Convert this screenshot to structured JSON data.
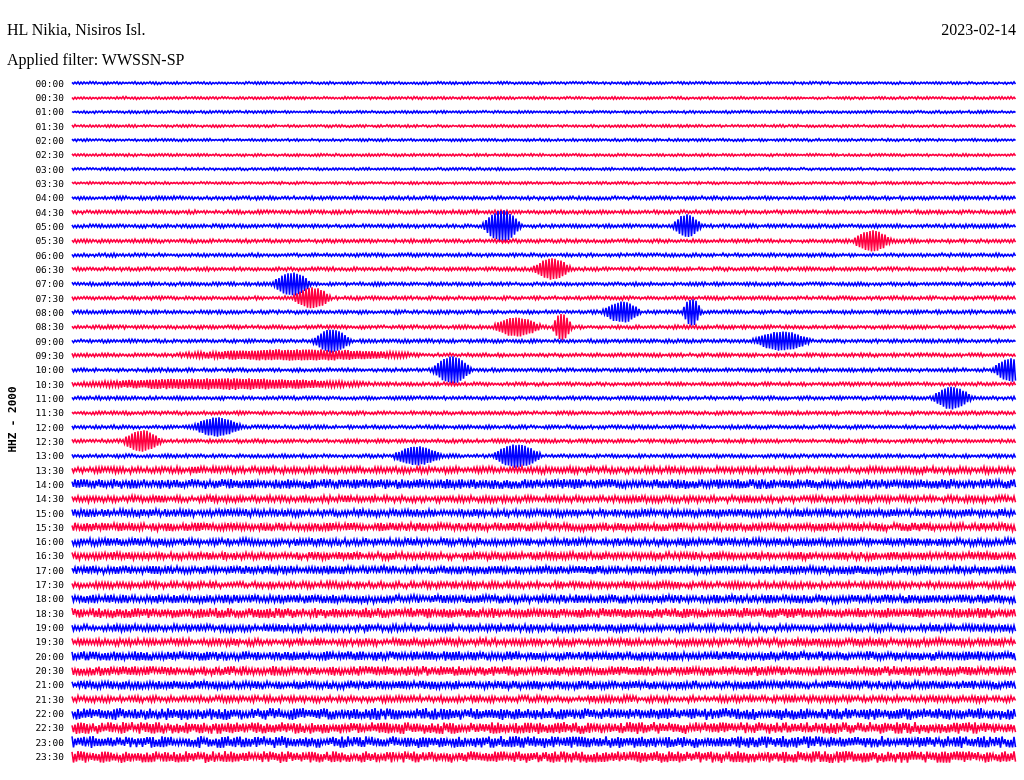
{
  "header": {
    "station": "HL Nikia, Nisiros Isl.",
    "date": "2023-02-14",
    "filter": "Applied filter: WWSSN-SP"
  },
  "plot": {
    "axis_label": "HHZ - 2000",
    "traces": [
      {
        "time": "00:00",
        "color": "#0000ff"
      },
      {
        "time": "00:30",
        "color": "#ff0040"
      },
      {
        "time": "01:00",
        "color": "#0000ff"
      },
      {
        "time": "01:30",
        "color": "#ff0040"
      },
      {
        "time": "02:00",
        "color": "#0000ff"
      },
      {
        "time": "02:30",
        "color": "#ff0040"
      },
      {
        "time": "03:00",
        "color": "#0000ff"
      },
      {
        "time": "03:30",
        "color": "#ff0040"
      },
      {
        "time": "04:00",
        "color": "#0000ff"
      },
      {
        "time": "04:30",
        "color": "#ff0040"
      },
      {
        "time": "05:00",
        "color": "#0000ff"
      },
      {
        "time": "05:30",
        "color": "#ff0040"
      },
      {
        "time": "06:00",
        "color": "#0000ff"
      },
      {
        "time": "06:30",
        "color": "#ff0040"
      },
      {
        "time": "07:00",
        "color": "#0000ff"
      },
      {
        "time": "07:30",
        "color": "#ff0040"
      },
      {
        "time": "08:00",
        "color": "#0000ff"
      },
      {
        "time": "08:30",
        "color": "#ff0040"
      },
      {
        "time": "09:00",
        "color": "#0000ff"
      },
      {
        "time": "09:30",
        "color": "#ff0040"
      },
      {
        "time": "10:00",
        "color": "#0000ff"
      },
      {
        "time": "10:30",
        "color": "#ff0040"
      },
      {
        "time": "11:00",
        "color": "#0000ff"
      },
      {
        "time": "11:30",
        "color": "#ff0040"
      },
      {
        "time": "12:00",
        "color": "#0000ff"
      },
      {
        "time": "12:30",
        "color": "#ff0040"
      },
      {
        "time": "13:00",
        "color": "#0000ff"
      },
      {
        "time": "13:30",
        "color": "#ff0040"
      },
      {
        "time": "14:00",
        "color": "#0000ff"
      },
      {
        "time": "14:30",
        "color": "#ff0040"
      },
      {
        "time": "15:00",
        "color": "#0000ff"
      },
      {
        "time": "15:30",
        "color": "#ff0040"
      },
      {
        "time": "16:00",
        "color": "#0000ff"
      },
      {
        "time": "16:30",
        "color": "#ff0040"
      },
      {
        "time": "17:00",
        "color": "#0000ff"
      },
      {
        "time": "17:30",
        "color": "#ff0040"
      },
      {
        "time": "18:00",
        "color": "#0000ff"
      },
      {
        "time": "18:30",
        "color": "#ff0040"
      },
      {
        "time": "19:00",
        "color": "#0000ff"
      },
      {
        "time": "19:30",
        "color": "#ff0040"
      },
      {
        "time": "20:00",
        "color": "#0000ff"
      },
      {
        "time": "20:30",
        "color": "#ff0040"
      },
      {
        "time": "21:00",
        "color": "#0000ff"
      },
      {
        "time": "21:30",
        "color": "#ff0040"
      },
      {
        "time": "22:00",
        "color": "#0000ff"
      },
      {
        "time": "22:30",
        "color": "#ff0040"
      },
      {
        "time": "23:00",
        "color": "#0000ff"
      },
      {
        "time": "23:30",
        "color": "#ff0040"
      }
    ]
  }
}
